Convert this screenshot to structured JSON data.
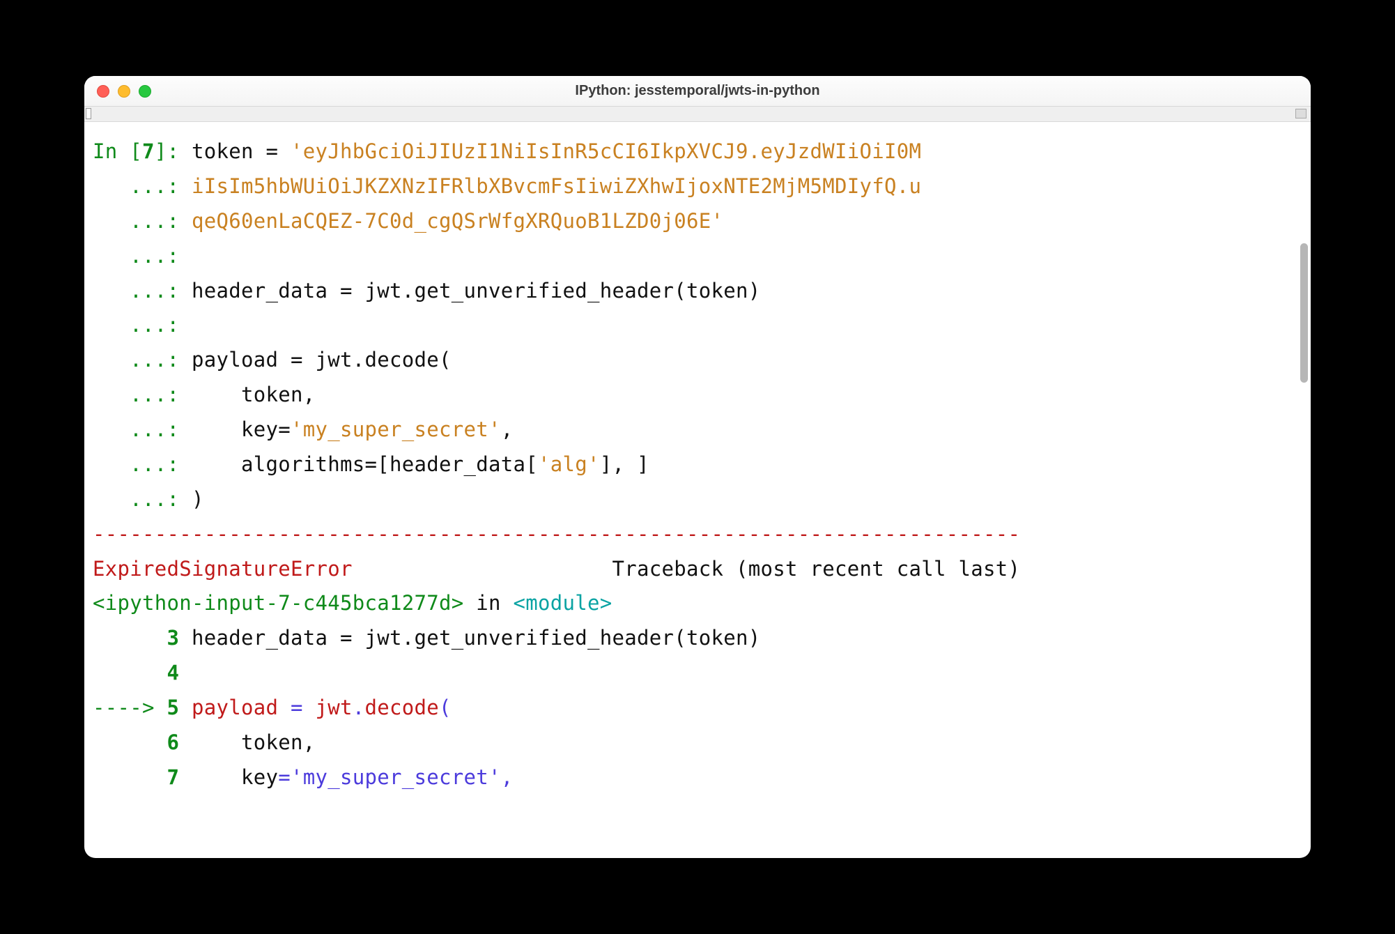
{
  "window": {
    "title": "IPython: jesstemporal/jwts-in-python"
  },
  "colors": {
    "green": "#0f8a1a",
    "orange": "#c98121",
    "red": "#c01a1a",
    "cyan": "#0aa3a3",
    "purple": "#4c3bdc",
    "black": "#111111"
  },
  "ipython": {
    "prompt_in": "In [",
    "prompt_num": "7",
    "prompt_close": "]: ",
    "continuation": "   ...: "
  },
  "code": {
    "assign_token": "token = ",
    "token_line1": "'eyJhbGciOiJIUzI1NiIsInR5cCI6IkpXVCJ9.eyJzdWIiOiI0M",
    "token_line2": "iIsIm5hbWUiOiJKZXNzIFRlbXBvcmFsIiwiZXhwIjoxNTE2MjM5MDIyfQ.u",
    "token_line3": "qeQ60enLaCQEZ-7C0d_cgQSrWfgXRQuoB1LZD0j06E'",
    "header_assign": "header_data = jwt.get_unverified_header(token)",
    "payload_l1": "payload = jwt.decode(",
    "payload_l2": "    token,",
    "payload_l3_pre": "    key=",
    "payload_l3_str": "'my_super_secret'",
    "payload_l3_post": ",",
    "payload_l4_pre": "    algorithms=[header_data[",
    "payload_l4_str": "'alg'",
    "payload_l4_post": "], ]",
    "payload_l5": ")"
  },
  "traceback": {
    "separator": "---------------------------------------------------------------------------",
    "error_name": "ExpiredSignatureError",
    "error_pad": "                     ",
    "tb_label": "Traceback (most recent call last)",
    "input_ref": "<ipython-input-7-c445bca1277d>",
    "in_word": " in ",
    "module_word": "<module>",
    "arrow": "----> ",
    "lines": [
      {
        "num": "3",
        "indent": "      ",
        "text": " header_data = jwt.get_unverified_header(token)"
      },
      {
        "num": "4",
        "indent": "      ",
        "text": " "
      },
      {
        "num": "5",
        "indent": "",
        "pre": " payload ",
        "eq": "=",
        "post": " jwt",
        "dot": ".",
        "call": "decode",
        "paren": "("
      },
      {
        "num": "6",
        "indent": "      ",
        "text": "     token,"
      },
      {
        "num": "7",
        "indent": "      ",
        "text_pre": "     key",
        "eq": "=",
        "str": "'my_super_secret'",
        "comma": ","
      }
    ]
  }
}
